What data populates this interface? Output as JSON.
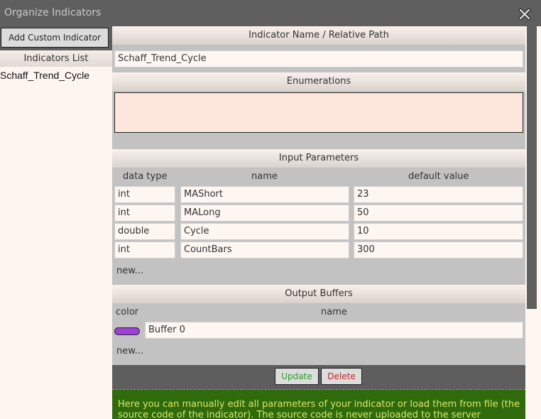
{
  "window": {
    "title": "Organize Indicators",
    "close_icon": "close-icon"
  },
  "sidebar": {
    "add_button": "Add Custom Indicator",
    "list_header": "Indicators List",
    "items": [
      "Schaff_Trend_Cycle"
    ]
  },
  "name_section": {
    "header": "Indicator Name / Relative Path",
    "value": "Schaff_Trend_Cycle"
  },
  "enumerations": {
    "header": "Enumerations",
    "value": ""
  },
  "input_parameters": {
    "header": "Input Parameters",
    "columns": [
      "data type",
      "name",
      "default value"
    ],
    "rows": [
      {
        "type": "int",
        "name": "MAShort",
        "default": "23"
      },
      {
        "type": "int",
        "name": "MALong",
        "default": "50"
      },
      {
        "type": "double",
        "name": "Cycle",
        "default": "10"
      },
      {
        "type": "int",
        "name": "CountBars",
        "default": "300"
      }
    ],
    "new_label": "new..."
  },
  "output_buffers": {
    "header": "Output Buffers",
    "columns": [
      "color",
      "name"
    ],
    "rows": [
      {
        "color": "#9d3fd6",
        "name": "Buffer 0"
      }
    ],
    "new_label": "new..."
  },
  "actions": {
    "update_label": "Update",
    "delete_label": "Delete"
  },
  "help_text": "Here you can manually edit all parameters of your indicator or load them from file (the source code of the indicator). The source code is never uploaded to the server",
  "colors": {
    "update": "#2a9d2a",
    "delete": "#c0282d",
    "help_bg": "#2f6a0c",
    "help_text": "#d9e86a"
  }
}
